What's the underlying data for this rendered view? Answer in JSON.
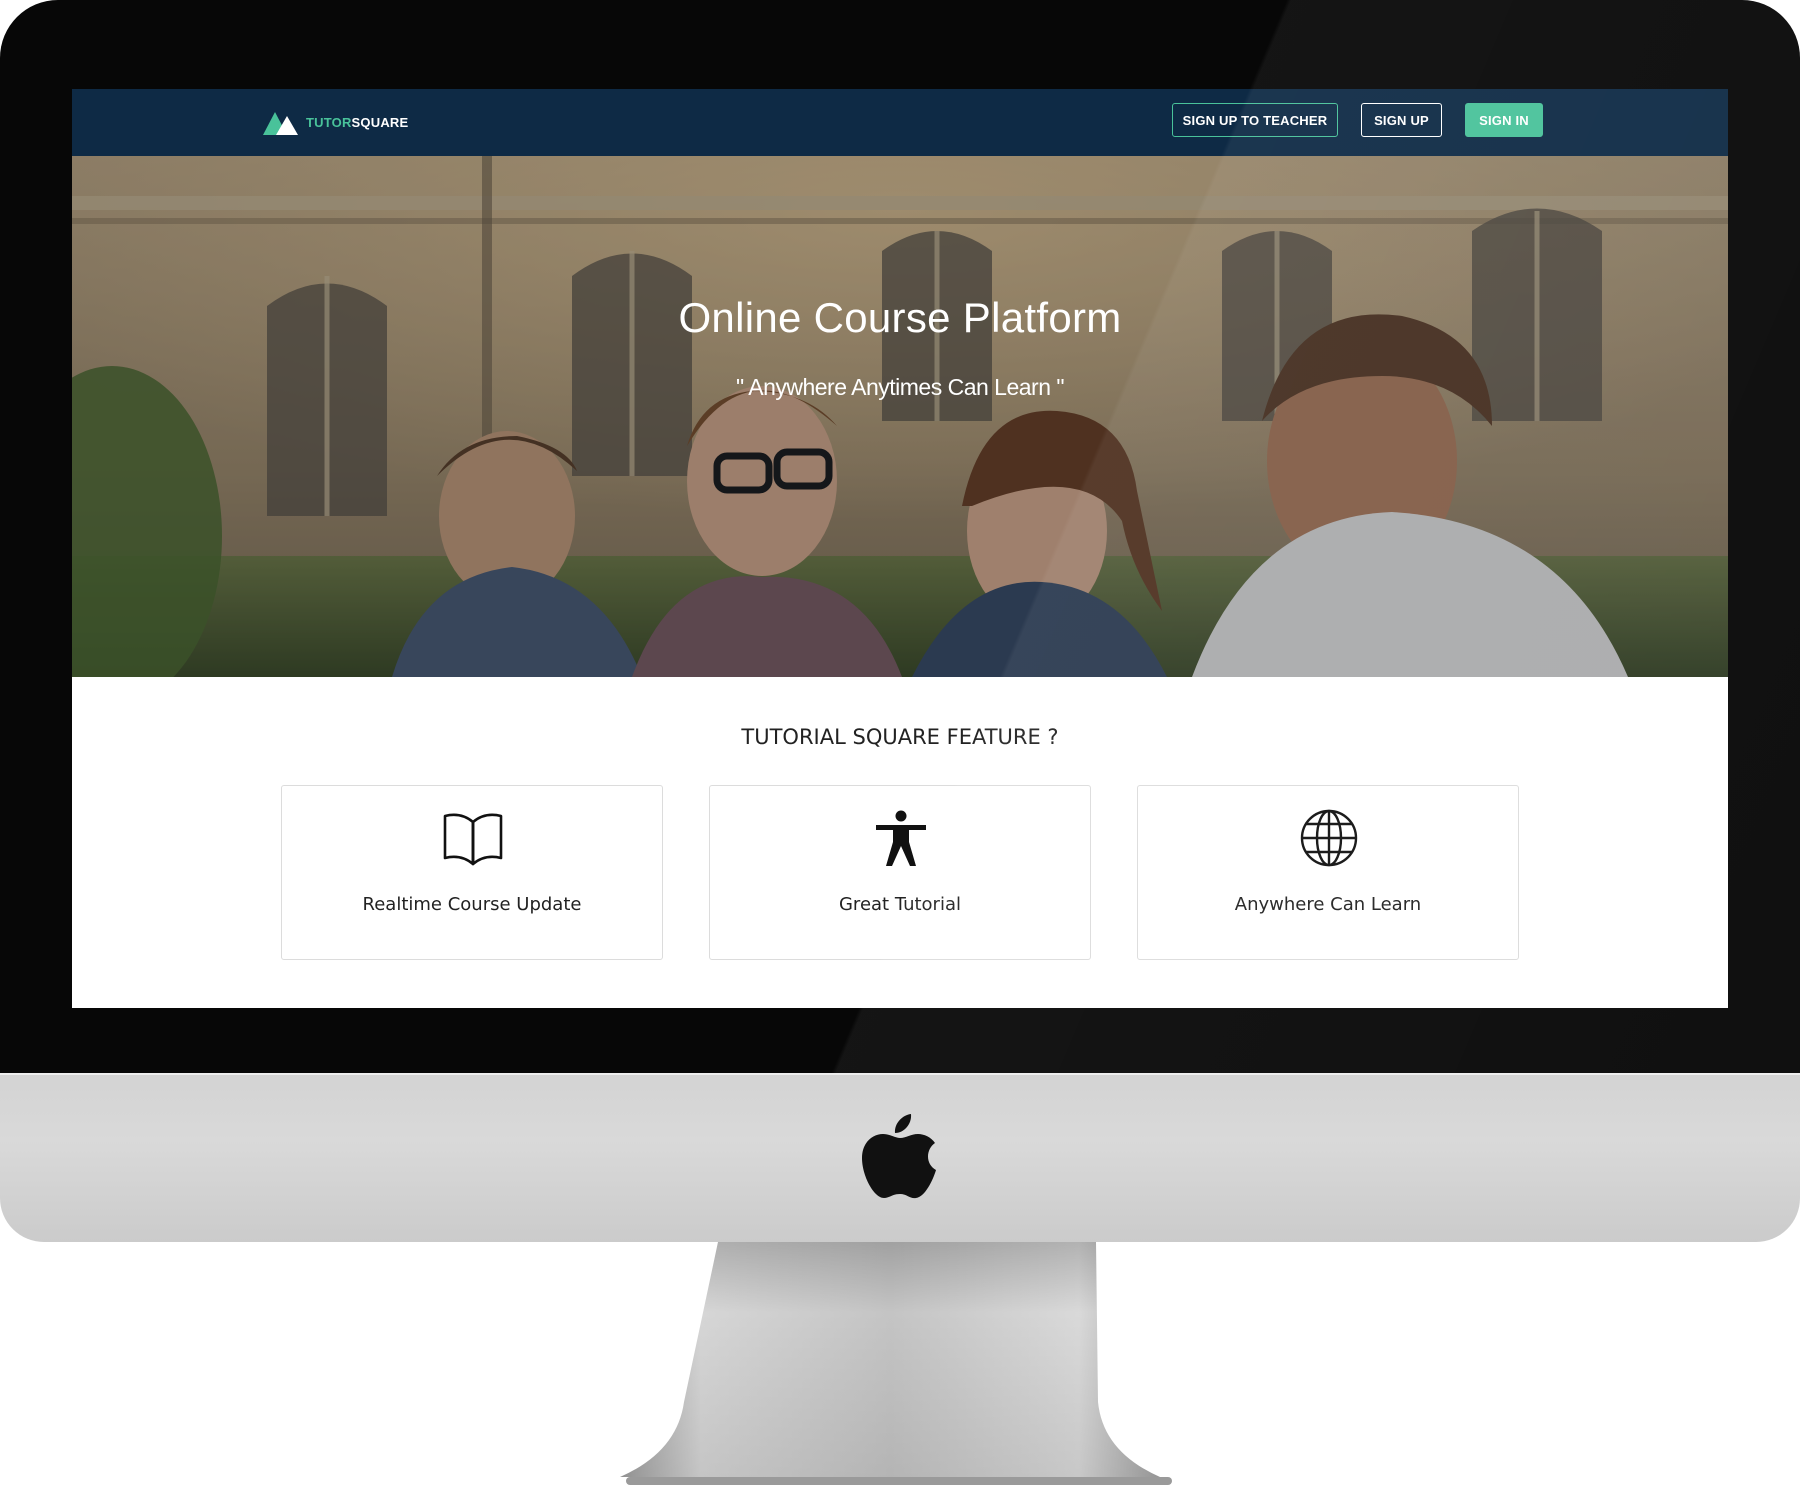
{
  "navbar": {
    "logo_part1": "TUTOR",
    "logo_part2": "SQUARE",
    "buttons": {
      "signup_teacher": "SIGN UP TO TEACHER",
      "signup": "SIGN UP",
      "signin": "SIGN IN"
    }
  },
  "hero": {
    "title": "Online Course Platform",
    "subtitle": "\" Anywhere Anytimes Can Learn \""
  },
  "features": {
    "title": "TUTORIAL SQUARE FEATURE ?",
    "cards": [
      {
        "label": "Realtime Course Update",
        "icon": "book-icon"
      },
      {
        "label": "Great Tutorial",
        "icon": "person-icon"
      },
      {
        "label": "Anywhere Can Learn",
        "icon": "globe-icon"
      }
    ]
  },
  "colors": {
    "navbar_bg": "#0e2a45",
    "accent": "#49c29a",
    "bezel": "#070707",
    "aluminum": "#d3d3d3"
  }
}
